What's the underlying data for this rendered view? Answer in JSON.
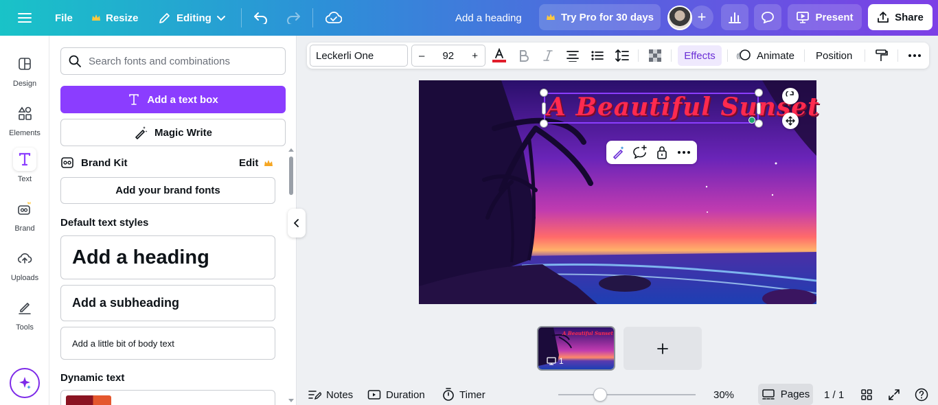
{
  "topbar": {
    "file_label": "File",
    "resize_label": "Resize",
    "editing_label": "Editing",
    "doc_title": "Add a heading",
    "try_pro_label": "Try Pro for 30 days",
    "present_label": "Present",
    "share_label": "Share",
    "gradient": [
      "#19c3c8",
      "#7d3fe6"
    ]
  },
  "rail": {
    "items": [
      {
        "label": "Design",
        "icon": "design-icon"
      },
      {
        "label": "Elements",
        "icon": "elements-icon"
      },
      {
        "label": "Text",
        "icon": "text-icon"
      },
      {
        "label": "Brand",
        "icon": "brand-icon"
      },
      {
        "label": "Uploads",
        "icon": "uploads-icon"
      },
      {
        "label": "Tools",
        "icon": "tools-icon"
      }
    ],
    "active": "Text"
  },
  "panel": {
    "search_placeholder": "Search fonts and combinations",
    "add_text_box_label": "Add a text box",
    "magic_write_label": "Magic Write",
    "brand_kit_label": "Brand Kit",
    "brand_kit_edit": "Edit",
    "add_brand_fonts_label": "Add your brand fonts",
    "default_styles_title": "Default text styles",
    "heading_label": "Add a heading",
    "subheading_label": "Add a subheading",
    "body_label": "Add a little bit of body text",
    "dynamic_text_title": "Dynamic text"
  },
  "context_toolbar": {
    "font_name": "Leckerli One",
    "font_size_minus": "–",
    "font_size": "92",
    "font_size_plus": "+",
    "text_color": "#e11d2b",
    "effects_label": "Effects",
    "animate_label": "Animate",
    "position_label": "Position"
  },
  "canvas": {
    "heading_text": "A Beautiful Sunset",
    "heading_color": "#ff2a4f"
  },
  "pages": {
    "thumb_title": "A Beautiful Sunset",
    "thumb_page_number": "1"
  },
  "bottombar": {
    "notes_label": "Notes",
    "duration_label": "Duration",
    "timer_label": "Timer",
    "zoom_level": "30%",
    "zoom_fraction": 0.3,
    "pages_label": "Pages",
    "page_counter": "1 / 1"
  }
}
